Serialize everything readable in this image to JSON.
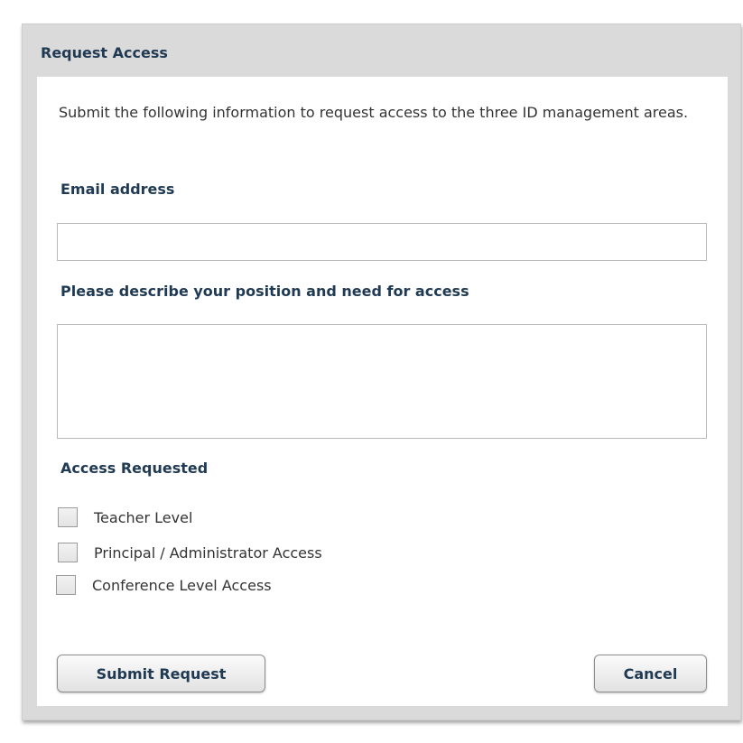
{
  "dialog": {
    "title": "Request Access",
    "intro": "Submit the following information to request access to the three ID management areas."
  },
  "form": {
    "email_label": "Email address",
    "email_value": "",
    "email_placeholder": "",
    "description_label": "Please describe your position and need for access",
    "description_value": "",
    "access_label": "Access Requested",
    "access_options": [
      {
        "label": "Teacher Level",
        "checked": false
      },
      {
        "label": "Principal / Administrator Access",
        "checked": false
      },
      {
        "label": "Conference Level Access",
        "checked": false
      }
    ]
  },
  "actions": {
    "submit_label": "Submit Request",
    "cancel_label": "Cancel"
  },
  "colors": {
    "dialog_background": "#dadada",
    "panel_background": "#ffffff",
    "heading_text": "#1f3a52",
    "body_text": "#333333"
  }
}
